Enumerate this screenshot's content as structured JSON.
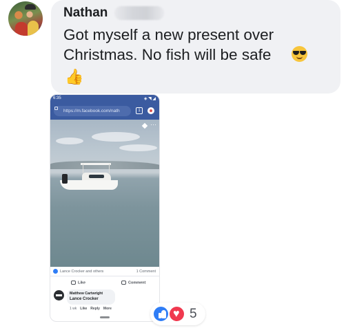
{
  "message": {
    "sender": "Nathan",
    "text": "Got myself a new present over Christmas. No fish will be safe",
    "emoji_inline": "sunglasses-emoji",
    "emoji_trailing": "👍"
  },
  "shared_screenshot": {
    "status_time": "6:35",
    "status_icons": "◈ ◥ ◢",
    "url": "https://m.facebook.com/nath",
    "tab_count": "1",
    "reactions_names": "Lance Crocker and others",
    "comment_count": "1 Comment",
    "like_action": "Like",
    "comment_action": "Comment",
    "comment": {
      "author": "Matthew Cartwright",
      "text": "Lance Crocker",
      "time": "1 wk",
      "like": "Like",
      "reply": "Reply",
      "more": "More"
    }
  },
  "reactions": {
    "types": [
      "like",
      "love"
    ],
    "count": "5"
  },
  "colors": {
    "bubble": "#f0f1f4",
    "facebook_blue": "#3b5ba0",
    "like_blue": "#2f7df6",
    "love_red": "#f0394f"
  }
}
